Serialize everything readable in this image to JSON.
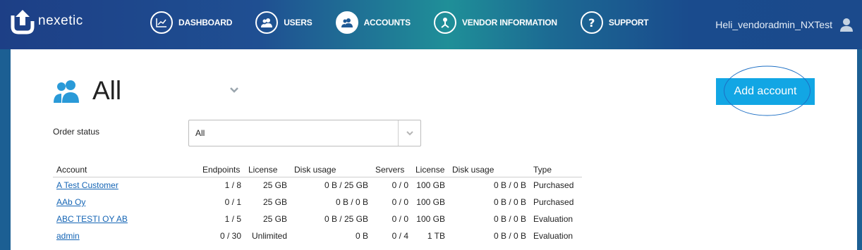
{
  "app": {
    "logo_text": "nexetic",
    "user_name": "Heli_vendoradmin_NXTest"
  },
  "nav": {
    "items": [
      {
        "label": "DASHBOARD",
        "icon": "chart-icon"
      },
      {
        "label": "USERS",
        "icon": "users-icon"
      },
      {
        "label": "ACCOUNTS",
        "icon": "accounts-icon"
      },
      {
        "label": "VENDOR INFORMATION",
        "icon": "vendor-icon"
      },
      {
        "label": "SUPPORT",
        "icon": "help-icon"
      }
    ],
    "active": "ACCOUNTS"
  },
  "page": {
    "title": "All",
    "add_button": "Add account",
    "order_status_label": "Order status",
    "order_status_value": "All"
  },
  "table": {
    "headers": [
      "Account",
      "Endpoints",
      "License",
      "Disk usage",
      "Servers",
      "License",
      "Disk usage",
      "Type"
    ],
    "rows": [
      [
        "A Test Customer",
        "1 / 8",
        "25 GB",
        "0 B / 25 GB",
        "0 / 0",
        "100 GB",
        "0 B / 0 B",
        "Purchased"
      ],
      [
        "AAb Oy",
        "0 / 1",
        "25 GB",
        "0 B / 0 B",
        "0 / 0",
        "100 GB",
        "0 B / 0 B",
        "Purchased"
      ],
      [
        "ABC TESTI OY AB",
        "1 / 5",
        "25 GB",
        "0 B / 25 GB",
        "0 / 0",
        "100 GB",
        "0 B / 0 B",
        "Evaluation"
      ],
      [
        "admin",
        "0 / 30",
        "Unlimited",
        "0 B",
        "0 / 4",
        "1 TB",
        "0 B / 0 B",
        "Evaluation"
      ]
    ]
  },
  "colors": {
    "accent": "#12a6e4",
    "link": "#1565b5",
    "header_bg": "#1f4f92"
  }
}
